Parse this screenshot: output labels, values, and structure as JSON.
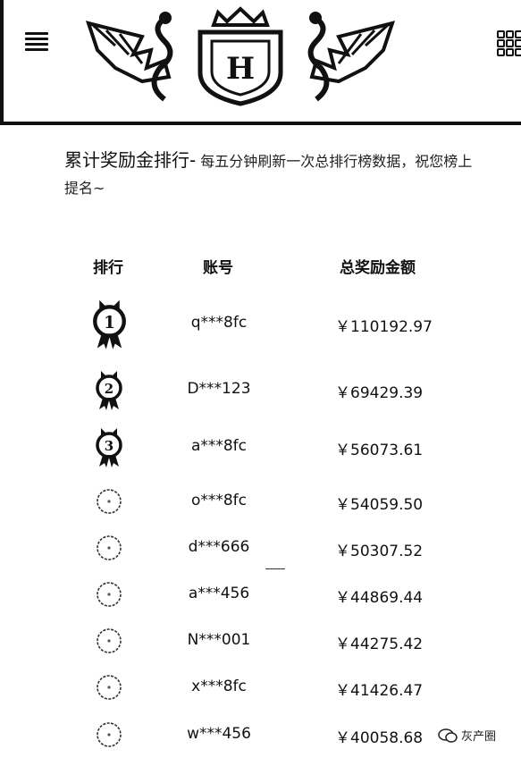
{
  "header": {
    "menu_icon": "hamburger-menu-icon",
    "grid_icon": "grid-icon",
    "logo_icon": "dragon-crest-logo"
  },
  "intro": {
    "title": "累计奖励金排行-",
    "description": " 每五分钟刷新一次总排行榜数据，祝您榜上提名~"
  },
  "table": {
    "headers": {
      "rank": "排行",
      "account": "账号",
      "amount": "总奖励金额"
    },
    "rows": [
      {
        "rank_icon": "medal-1-icon",
        "account": "q***8fc",
        "amount": "￥110192.97"
      },
      {
        "rank_icon": "medal-2-icon",
        "account": "D***123",
        "amount": "￥69429.39"
      },
      {
        "rank_icon": "medal-3-icon",
        "account": "a***8fc",
        "amount": "￥56073.61"
      },
      {
        "rank_icon": "rank-circle-icon",
        "account": "o***8fc",
        "amount": "￥54059.50"
      },
      {
        "rank_icon": "rank-circle-icon",
        "account": "d***666",
        "amount": "￥50307.52"
      },
      {
        "rank_icon": "rank-circle-icon",
        "account": "a***456",
        "amount": "￥44869.44"
      },
      {
        "rank_icon": "rank-circle-icon",
        "account": "N***001",
        "amount": "￥44275.42"
      },
      {
        "rank_icon": "rank-circle-icon",
        "account": "x***8fc",
        "amount": "￥41426.47"
      },
      {
        "rank_icon": "rank-circle-icon",
        "account": "w***456",
        "amount": "￥40058.68"
      }
    ]
  },
  "watermark": {
    "text": "灰产圈"
  }
}
